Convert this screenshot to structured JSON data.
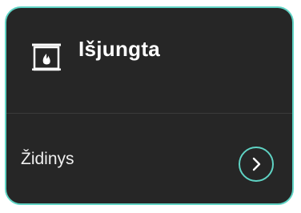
{
  "card": {
    "status": "Išjungta",
    "device_name": "Židinys",
    "icon": "fireplace-icon",
    "action_icon": "chevron-right-icon"
  },
  "colors": {
    "background": "#262626",
    "accent": "#5fd3c4",
    "text": "#ffffff",
    "divider": "#3a3a3a"
  }
}
